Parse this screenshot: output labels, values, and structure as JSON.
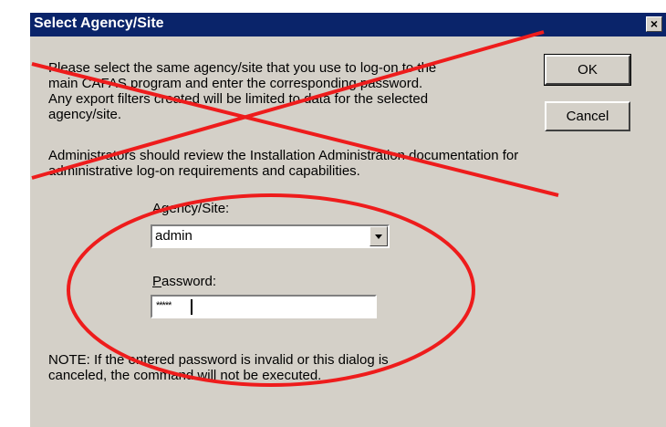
{
  "dialog": {
    "title": "Select Agency/Site",
    "close_glyph": "×"
  },
  "intro": {
    "line1": "Please select the same agency/site that you use to log-on to the",
    "line2": "main CAFAS program and enter the corresponding password.",
    "line3": "Any export filters created will be limited to data for the selected",
    "line4": "agency/site."
  },
  "admin_note": {
    "line1": "Administrators should review the Installation Administration documentation for",
    "line2": "administrative log-on requirements and capabilities."
  },
  "buttons": {
    "ok": "OK",
    "cancel": "Cancel"
  },
  "agency": {
    "label": "Agency/Site:",
    "value": "admin"
  },
  "password": {
    "label_mnemonic": "P",
    "label_rest": "assword:",
    "value": "*****"
  },
  "note": {
    "line1": "NOTE:  If the entered password is invalid or this dialog is",
    "line2": "canceled, the command will not be executed."
  },
  "annotation_colors": {
    "cross_out": "#ee1c1c",
    "circle": "#ee1c1c"
  }
}
